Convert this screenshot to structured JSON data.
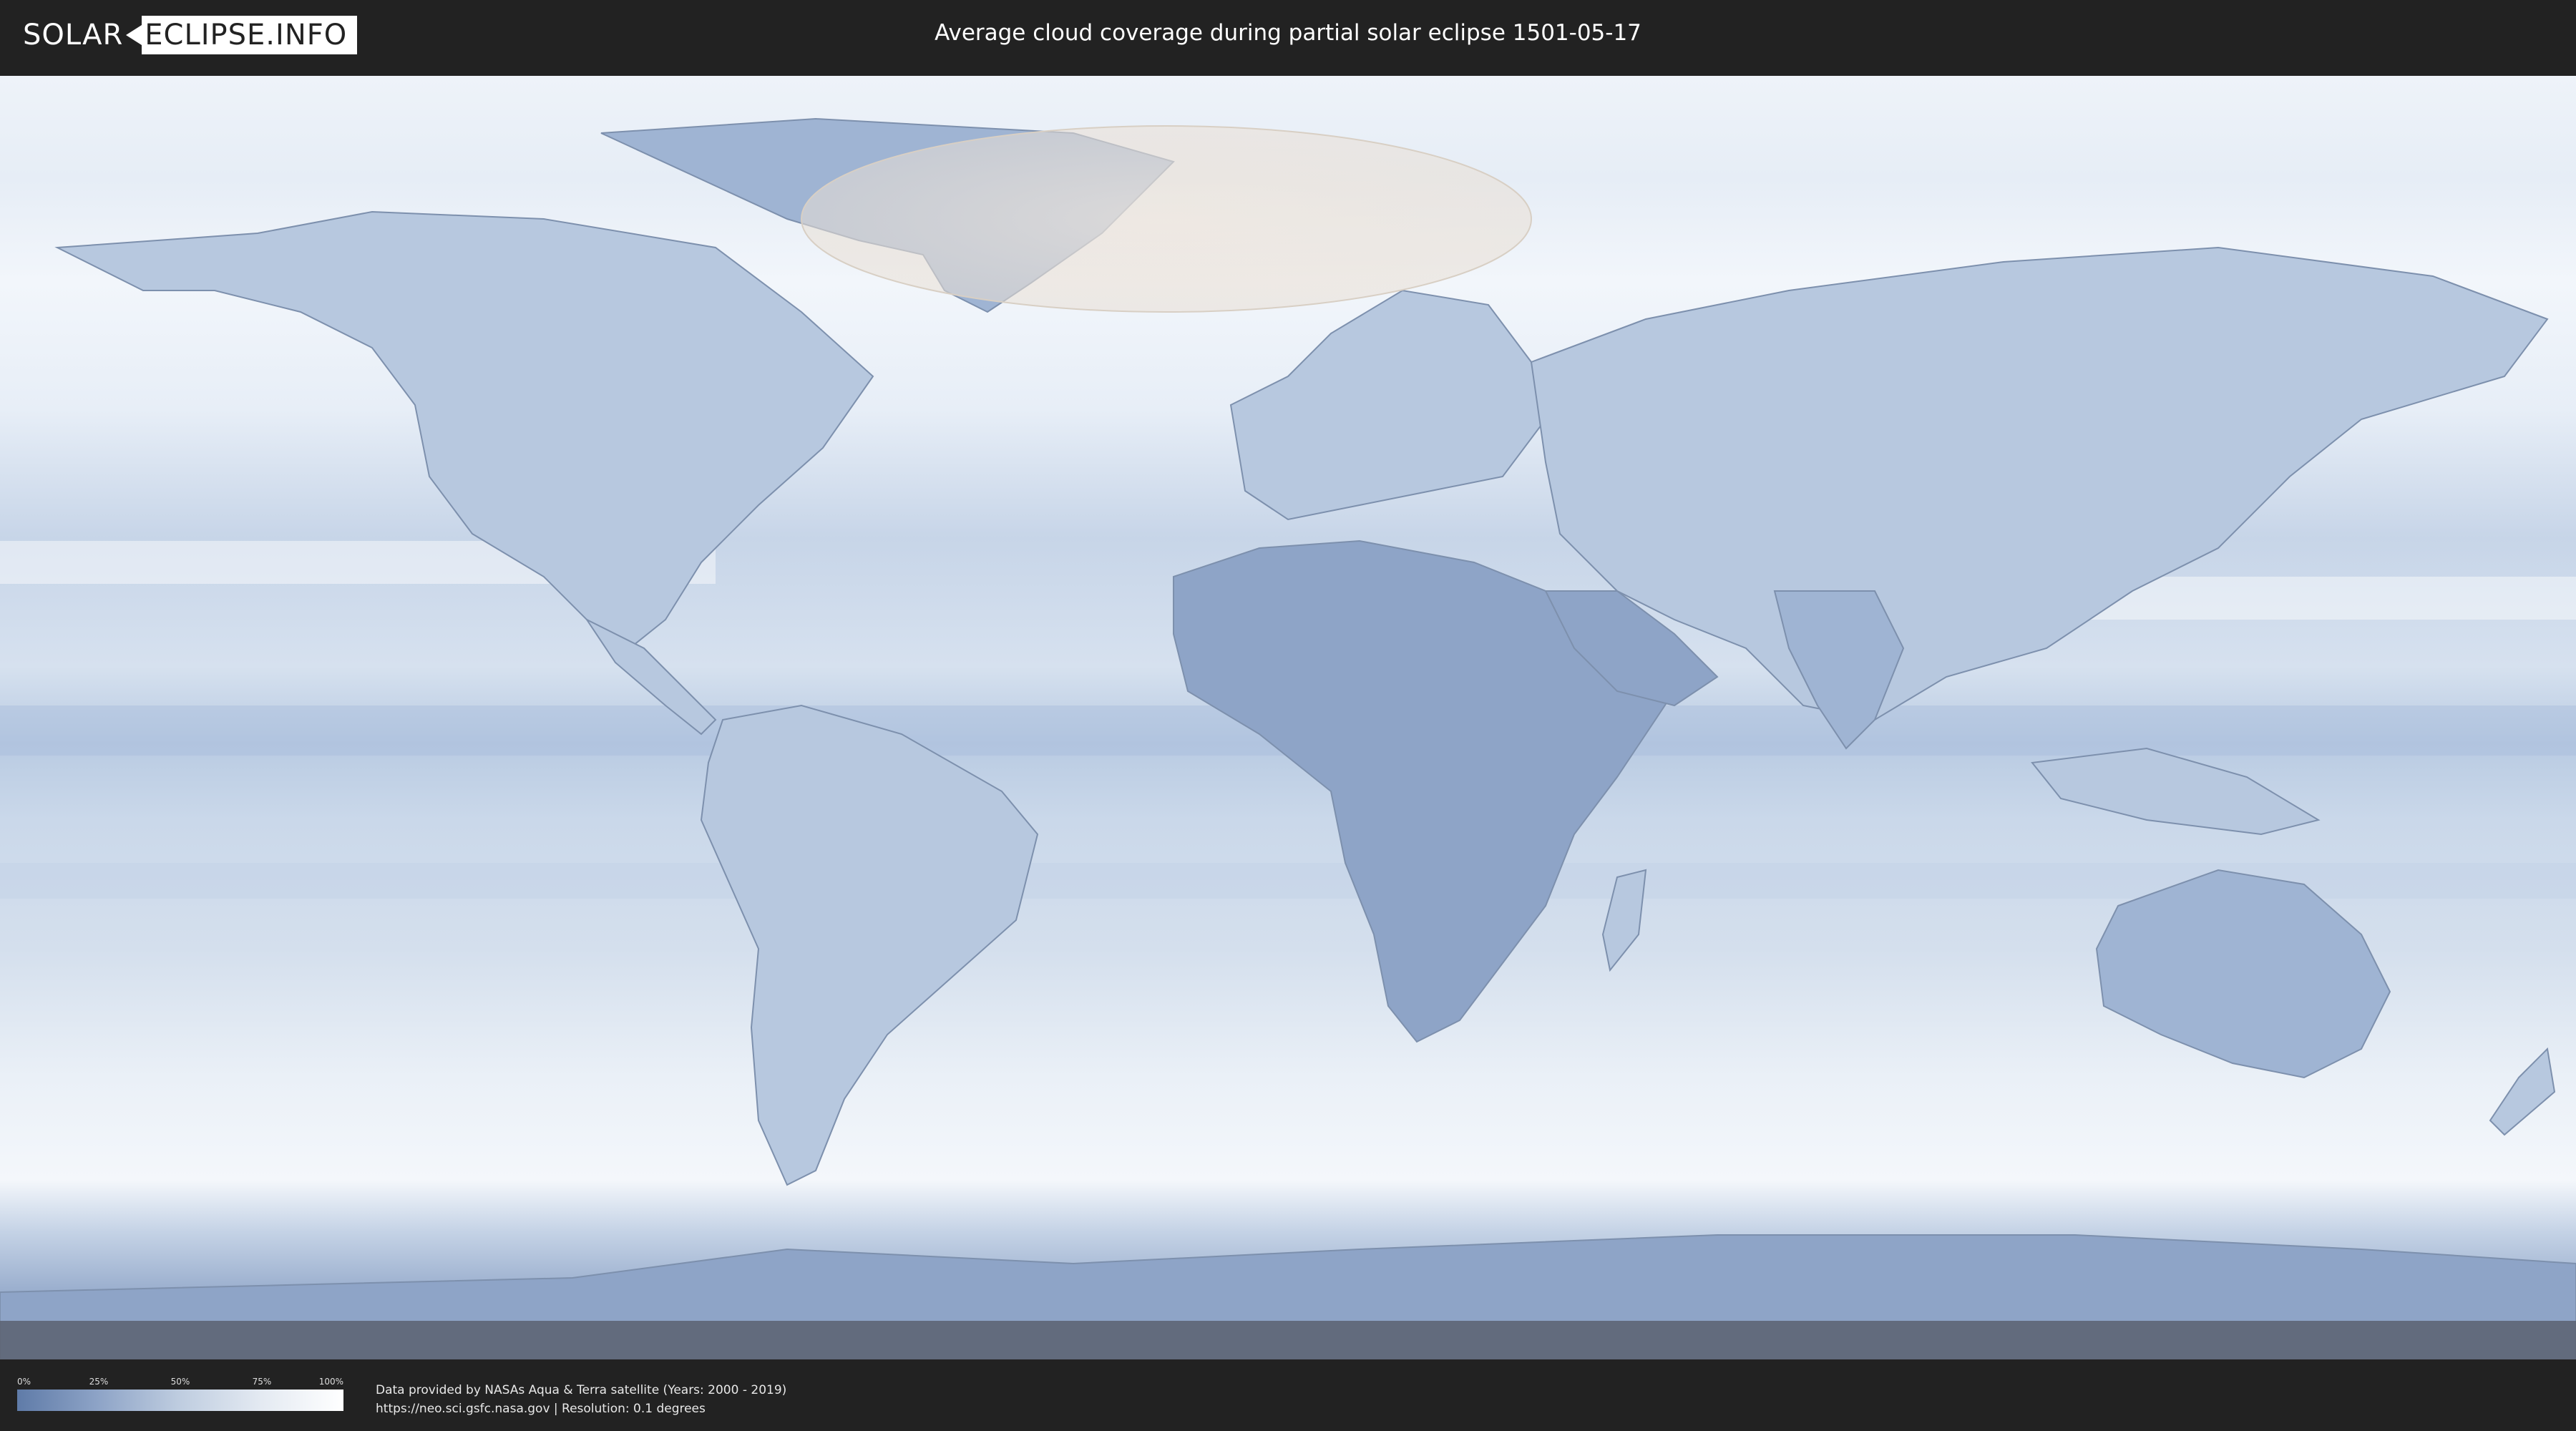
{
  "header": {
    "logo_left": "SOLAR",
    "logo_right": "ECLIPSE.INFO",
    "title": "Average cloud coverage during partial solar eclipse 1501-05-17"
  },
  "map": {
    "projection": "equirectangular world map",
    "eclipse_region": "partial eclipse visibility zone over Greenland, North Atlantic and Scandinavia",
    "colors": {
      "clear_sky": "#5f7ba8",
      "cloudy": "#ffffff",
      "eclipse_overlay": "#f0e6dc",
      "coastline": "#6b7f9c"
    }
  },
  "legend": {
    "ticks": [
      "0%",
      "25%",
      "50%",
      "75%",
      "100%"
    ],
    "gradient_colors": [
      "#5f7ba8",
      "#8ea4c7",
      "#bfcde0",
      "#e4eaf2",
      "#ffffff"
    ]
  },
  "footer": {
    "credit_line1": "Data provided by NASAs Aqua & Terra satellite (Years: 2000 - 2019)",
    "credit_line2": "https://neo.sci.gsfc.nasa.gov | Resolution: 0.1 degrees"
  }
}
